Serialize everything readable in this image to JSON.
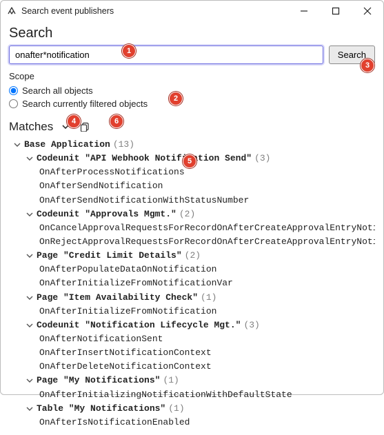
{
  "window": {
    "title": "Search event publishers"
  },
  "search": {
    "heading": "Search",
    "value": "onafter*notification",
    "button": "Search"
  },
  "scope": {
    "label": "Scope",
    "options": [
      {
        "label": "Search all objects",
        "checked": true
      },
      {
        "label": "Search currently filtered objects",
        "checked": false
      }
    ]
  },
  "matches": {
    "label": "Matches"
  },
  "tree": {
    "root": {
      "label": "Base Application",
      "count": "(13)",
      "nodes": [
        {
          "label": "Codeunit \"API Webhook Notification Send\"",
          "count": "(3)",
          "items": [
            "OnAfterProcessNotifications",
            "OnAfterSendNotification",
            "OnAfterSendNotificationWithStatusNumber"
          ]
        },
        {
          "label": "Codeunit \"Approvals Mgmt.\"",
          "count": "(2)",
          "items": [
            "OnCancelApprovalRequestsForRecordOnAfterCreateApprovalEntryNotificati",
            "OnRejectApprovalRequestsForRecordOnAfterCreateApprovalEntryNotificati"
          ]
        },
        {
          "label": "Page \"Credit Limit Details\"",
          "count": "(2)",
          "items": [
            "OnAfterPopulateDataOnNotification",
            "OnAfterInitializeFromNotificationVar"
          ]
        },
        {
          "label": "Page \"Item Availability Check\"",
          "count": "(1)",
          "items": [
            "OnAfterInitializeFromNotification"
          ]
        },
        {
          "label": "Codeunit \"Notification Lifecycle Mgt.\"",
          "count": "(3)",
          "items": [
            "OnAfterNotificationSent",
            "OnAfterInsertNotificationContext",
            "OnAfterDeleteNotificationContext"
          ]
        },
        {
          "label": "Page \"My Notifications\"",
          "count": "(1)",
          "items": [
            "OnAfterInitializingNotificationWithDefaultState"
          ]
        },
        {
          "label": "Table \"My Notifications\"",
          "count": "(1)",
          "items": [
            "OnAfterIsNotificationEnabled"
          ]
        }
      ]
    }
  },
  "badges": {
    "b1": "1",
    "b2": "2",
    "b3": "3",
    "b4": "4",
    "b5": "5",
    "b6": "6"
  }
}
